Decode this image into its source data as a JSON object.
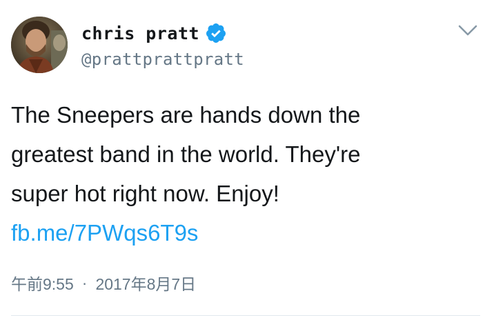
{
  "tweet": {
    "display_name": "chris pratt",
    "handle": "@prattprattpratt",
    "text_lines": [
      "The Sneepers are hands down the",
      "greatest band in the world. They're",
      "super hot right now. Enjoy!"
    ],
    "link": "fb.me/7PWqs6T9s",
    "time": "午前9:55",
    "separator": "·",
    "date": "2017年8月7日"
  },
  "icons": {
    "verified": "verified-badge-icon",
    "menu": "chevron-down-icon"
  },
  "colors": {
    "link": "#1da1f2",
    "verified": "#1da1f2",
    "secondary_text": "#657786",
    "primary_text": "#14171a"
  }
}
